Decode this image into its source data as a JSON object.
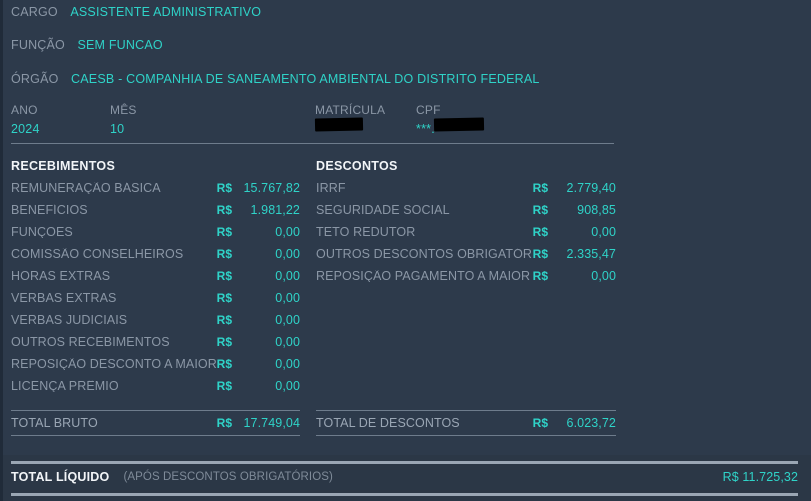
{
  "identification": [
    {
      "label": "CARGO",
      "value": "ASSISTENTE ADMINISTRATIVO"
    },
    {
      "label": "FUNÇÃO",
      "value": "SEM FUNCAO"
    },
    {
      "label": "ÓRGÃO",
      "value": "CAESB - COMPANHIA DE SANEAMENTO AMBIENTAL DO DISTRITO FEDERAL"
    }
  ],
  "fields": {
    "ano": {
      "label": "ANO",
      "value": "2024"
    },
    "mes": {
      "label": "MÊS",
      "value": "10"
    },
    "matricula": {
      "label": "MATRÍCULA",
      "value": "",
      "redacted": true
    },
    "cpf": {
      "label": "CPF",
      "value": "***.         -**",
      "redacted": true
    }
  },
  "receipts": {
    "title": "RECEBIMENTOS",
    "currency": "R$",
    "rows": [
      {
        "name": "REMUNERAÇÃO BÁSICA",
        "currency": "R$",
        "amount": "15.767,82"
      },
      {
        "name": "BENEFÍCIOS",
        "currency": "R$",
        "amount": "1.981,22"
      },
      {
        "name": "FUNÇÕES",
        "currency": "R$",
        "amount": "0,00"
      },
      {
        "name": "COMISSÃO CONSELHEIROS",
        "currency": "R$",
        "amount": "0,00"
      },
      {
        "name": "HORAS EXTRAS",
        "currency": "R$",
        "amount": "0,00"
      },
      {
        "name": "VERBAS EXTRAS",
        "currency": "R$",
        "amount": "0,00"
      },
      {
        "name": "VERBAS JUDICIAIS",
        "currency": "R$",
        "amount": "0,00"
      },
      {
        "name": "OUTROS RECEBIMENTOS",
        "currency": "R$",
        "amount": "0,00"
      },
      {
        "name": "REPOSIÇÃO DESCONTO A MAIOR",
        "currency": "R$",
        "amount": "0,00"
      },
      {
        "name": "LICENÇA PRÊMIO",
        "currency": "R$",
        "amount": "0,00"
      }
    ],
    "total": {
      "name": "TOTAL BRUTO",
      "currency": "R$",
      "amount": "17.749,04"
    }
  },
  "deductions": {
    "title": "DESCONTOS",
    "currency": "R$",
    "rows": [
      {
        "name": "IRRF",
        "currency": "R$",
        "amount": "2.779,40"
      },
      {
        "name": "SEGURIDADE SOCIAL",
        "currency": "R$",
        "amount": "908,85"
      },
      {
        "name": "TETO REDUTOR",
        "currency": "R$",
        "amount": "0,00"
      },
      {
        "name": "OUTROS DESCONTOS OBRIGATÓRIOS",
        "currency": "R$",
        "amount": "2.335,47"
      },
      {
        "name": "REPOSIÇÃO PAGAMENTO A MAIOR",
        "currency": "R$",
        "amount": "0,00"
      }
    ],
    "total": {
      "name": "TOTAL DE DESCONTOS",
      "currency": "R$",
      "amount": "6.023,72"
    }
  },
  "net": {
    "label": "TOTAL LÍQUIDO",
    "note": "(APÓS DESCONTOS OBRIGATÓRIOS)",
    "amount": "R$ 11.725,32"
  },
  "colors": {
    "background": "#2d3a4b",
    "net_background": "#2b3746",
    "accent_teal": "#2fd3c8",
    "label_gray": "#8b97a6",
    "rule_gray": "#6e7c8c",
    "heading_white": "#f2f5f8",
    "redaction_black": "#000000"
  }
}
